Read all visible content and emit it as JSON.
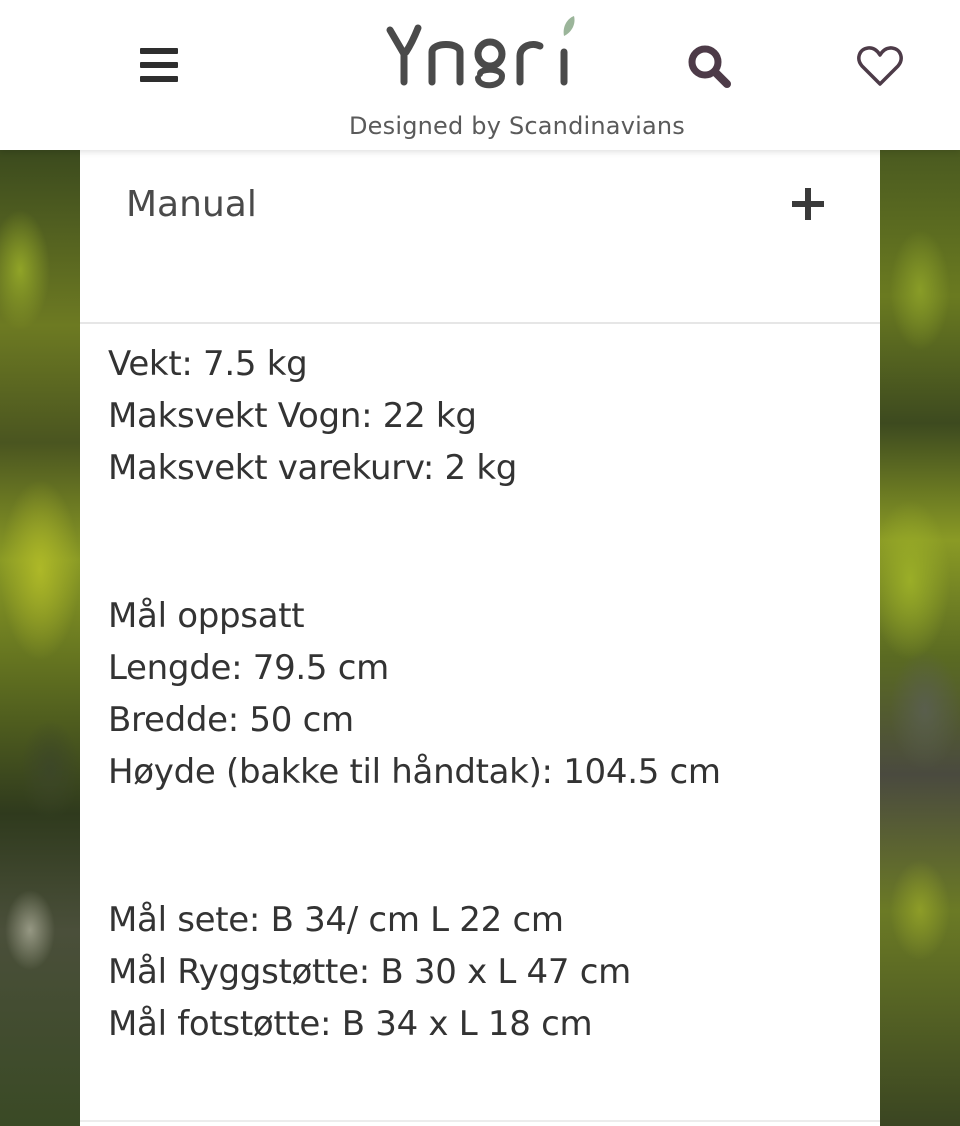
{
  "header": {
    "brand": "Yngri",
    "tagline": "Designed by Scandinavians",
    "icons": {
      "menu": "hamburger-menu-icon",
      "search": "search-icon",
      "favorites": "heart-icon"
    },
    "colors": {
      "brand_dark": "#4a4a4a",
      "brand_leaf": "#9bb59a",
      "icon_search": "#4d3b48"
    }
  },
  "accordion": {
    "title": "Manual",
    "toggle_icon": "plus-icon"
  },
  "specs": {
    "weight": [
      "Vekt: 7.5 kg",
      "Maksvekt Vogn: 22 kg",
      "Maksvekt varekurv: 2 kg"
    ],
    "dimensions_title": "Mål oppsatt",
    "dimensions": [
      "Lengde: 79.5 cm",
      "Bredde: 50 cm",
      "Høyde (bakke til håndtak): 104.5 cm"
    ],
    "parts": [
      "Mål sete: B 34/ cm L 22 cm",
      "Mål Ryggstøtte: B 30 x L 47 cm",
      "Mål fotstøtte: B 34 x L 18 cm"
    ]
  }
}
